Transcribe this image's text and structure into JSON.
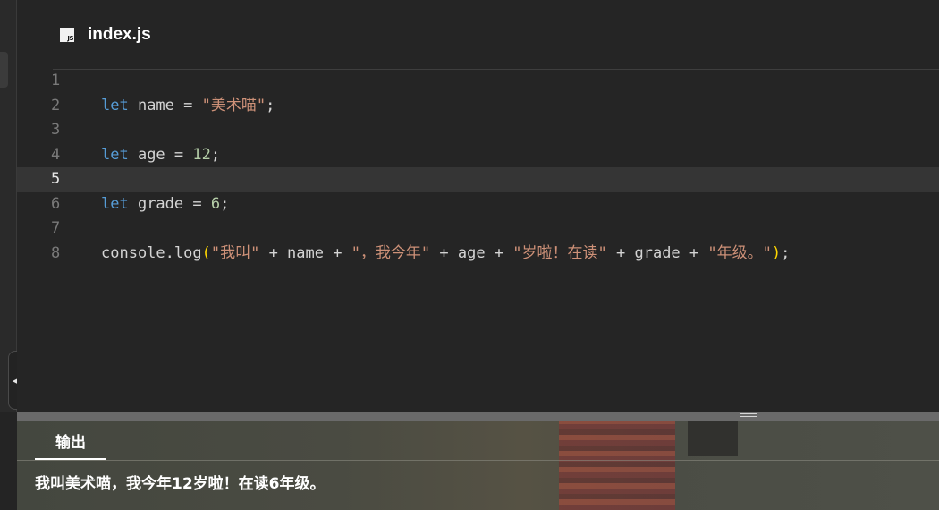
{
  "editor": {
    "file_icon_label": "JS",
    "file_name": "index.js",
    "active_line": 5,
    "lines": [
      {
        "number": "1",
        "tokens": []
      },
      {
        "number": "2",
        "tokens": [
          {
            "t": "kw",
            "v": "let"
          },
          {
            "t": "plain",
            "v": " name = "
          },
          {
            "t": "str",
            "v": "\"美术喵\""
          },
          {
            "t": "plain",
            "v": ";"
          }
        ]
      },
      {
        "number": "3",
        "tokens": []
      },
      {
        "number": "4",
        "tokens": [
          {
            "t": "kw",
            "v": "let"
          },
          {
            "t": "plain",
            "v": " age = "
          },
          {
            "t": "num",
            "v": "12"
          },
          {
            "t": "plain",
            "v": ";"
          }
        ]
      },
      {
        "number": "5",
        "tokens": []
      },
      {
        "number": "6",
        "tokens": [
          {
            "t": "kw",
            "v": "let"
          },
          {
            "t": "plain",
            "v": " grade = "
          },
          {
            "t": "num",
            "v": "6"
          },
          {
            "t": "plain",
            "v": ";"
          }
        ]
      },
      {
        "number": "7",
        "tokens": []
      },
      {
        "number": "8",
        "tokens": [
          {
            "t": "plain",
            "v": "console.log"
          },
          {
            "t": "paren",
            "v": "("
          },
          {
            "t": "str",
            "v": "\"我叫\""
          },
          {
            "t": "plain",
            "v": " + name + "
          },
          {
            "t": "str",
            "v": "\"，我今年\""
          },
          {
            "t": "plain",
            "v": " + age + "
          },
          {
            "t": "str",
            "v": "\"岁啦！在读\""
          },
          {
            "t": "plain",
            "v": " + grade + "
          },
          {
            "t": "str",
            "v": "\"年级。\""
          },
          {
            "t": "paren",
            "v": ")"
          },
          {
            "t": "plain",
            "v": ";"
          }
        ]
      }
    ]
  },
  "output": {
    "tab_label": "输出",
    "text": "我叫美术喵，我今年12岁啦！在读6年级。"
  },
  "icons": {
    "collapse": "chevron-left-icon",
    "splitter": "drag-handle-icon",
    "file": "js-file-icon"
  },
  "colors": {
    "keyword": "#569cd6",
    "string": "#ce9178",
    "number": "#b5cea8",
    "paren": "#ffd700",
    "editor_bg": "#252525"
  }
}
